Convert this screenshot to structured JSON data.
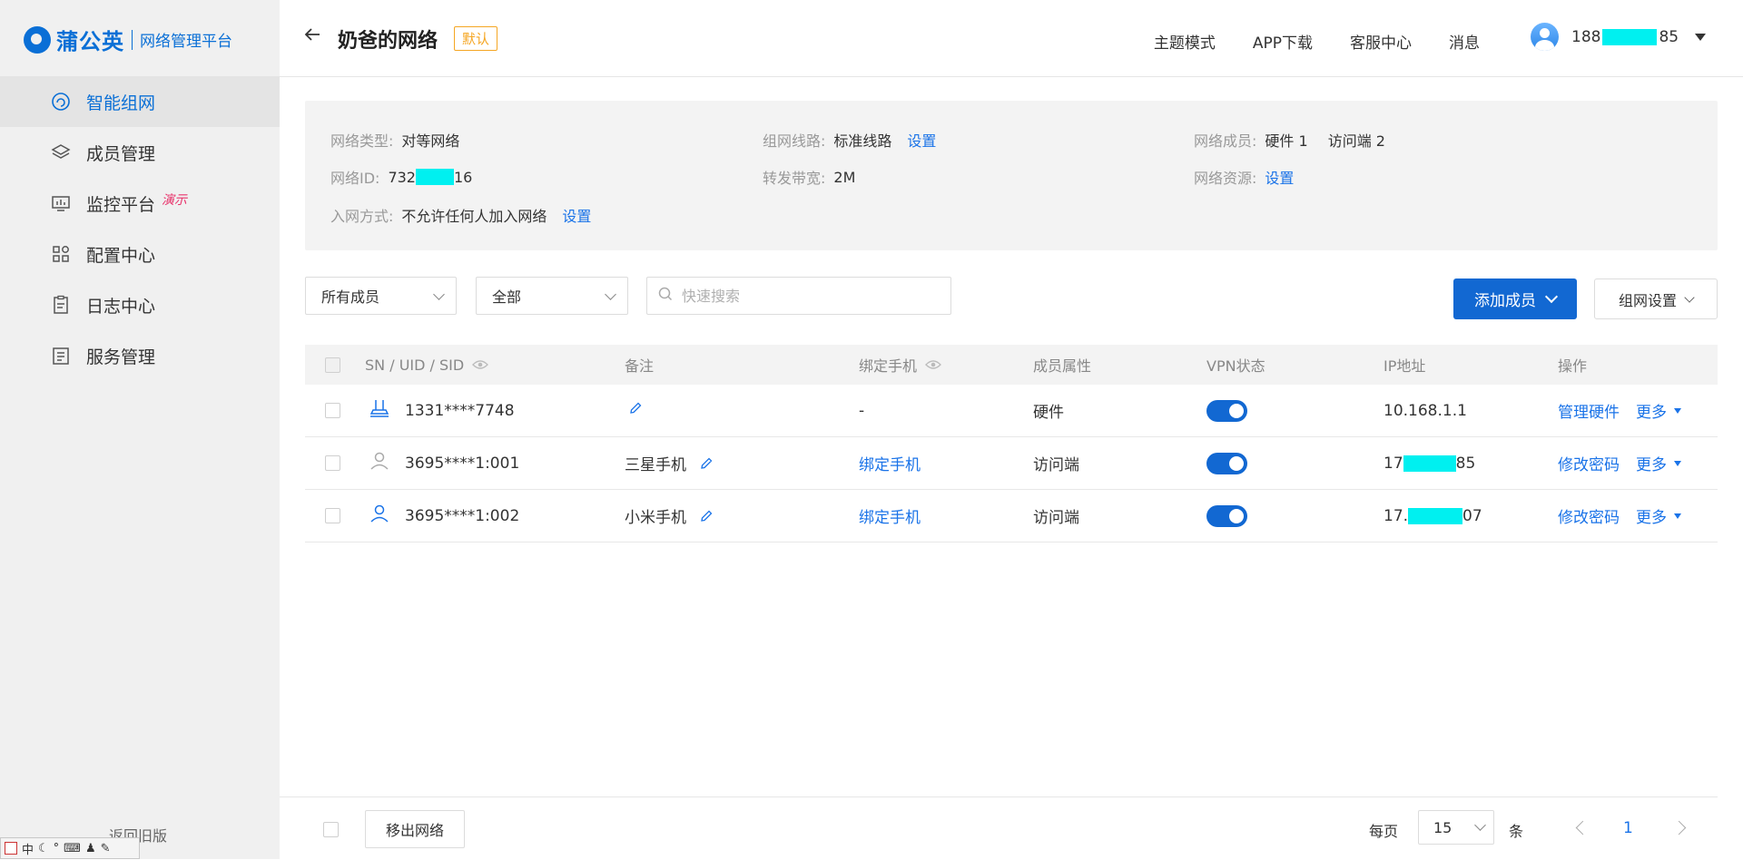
{
  "brand": {
    "name": "蒲公英",
    "subtitle": "网络管理平台"
  },
  "sidebar": {
    "items": [
      {
        "label": "智能组网",
        "icon": "network-icon",
        "active": true
      },
      {
        "label": "成员管理",
        "icon": "layers-icon"
      },
      {
        "label": "监控平台",
        "icon": "monitor-icon",
        "badge": "演示"
      },
      {
        "label": "配置中心",
        "icon": "grid-apps-icon"
      },
      {
        "label": "日志中心",
        "icon": "clipboard-icon"
      },
      {
        "label": "服务管理",
        "icon": "list-doc-icon"
      }
    ],
    "return_old": "返回旧版"
  },
  "ime": {
    "label": "中"
  },
  "header": {
    "title": "奶爸的网络",
    "tag": "默认",
    "links": [
      "主题模式",
      "APP下载",
      "客服中心",
      "消息"
    ],
    "user": {
      "phone_prefix": "188",
      "phone_suffix": "85"
    }
  },
  "info": {
    "network_type_label": "网络类型:",
    "network_type_value": "对等网络",
    "network_id_label": "网络ID:",
    "network_id_prefix": "732",
    "network_id_suffix": "16",
    "join_label": "入网方式:",
    "join_value": "不允许任何人加入网络",
    "join_link": "设置",
    "line_label": "组网线路:",
    "line_value": "标准线路",
    "line_link": "设置",
    "bandwidth_label": "转发带宽:",
    "bandwidth_value": "2M",
    "members_label": "网络成员:",
    "members_hw": "硬件 1",
    "members_client": "访问端 2",
    "resource_label": "网络资源:",
    "resource_link": "设置"
  },
  "filters": {
    "member_filter": "所有成员",
    "type_filter": "全部",
    "search_placeholder": "快速搜索",
    "add_member": "添加成员",
    "network_settings": "组网设置"
  },
  "table": {
    "headers": {
      "sn": "SN / UID / SID",
      "remark": "备注",
      "phone": "绑定手机",
      "attr": "成员属性",
      "vpn": "VPN状态",
      "ip": "IP地址",
      "ops": "操作"
    },
    "rows": [
      {
        "icon": "router-icon",
        "sn": "1331****7748",
        "remark": "",
        "phone": "-",
        "phone_is_link": false,
        "attr": "硬件",
        "vpn_on": true,
        "ip_prefix": "10.168.1.1",
        "ip_suffix": "",
        "ip_masked": false,
        "op": "管理硬件",
        "more": "更多"
      },
      {
        "icon": "user-gray-icon",
        "sn": "3695****1:001",
        "remark": "三星手机",
        "phone": "绑定手机",
        "phone_is_link": true,
        "attr": "访问端",
        "vpn_on": true,
        "ip_prefix": "17",
        "ip_suffix": "85",
        "ip_masked": true,
        "op": "修改密码",
        "more": "更多"
      },
      {
        "icon": "user-blue-icon",
        "sn": "3695****1:002",
        "remark": "小米手机",
        "phone": "绑定手机",
        "phone_is_link": true,
        "attr": "访问端",
        "vpn_on": true,
        "ip_prefix": "17.",
        "ip_suffix": "07",
        "ip_masked": true,
        "op": "修改密码",
        "more": "更多"
      }
    ]
  },
  "footer": {
    "move_out": "移出网络",
    "per_page_label": "每页",
    "page_size": "15",
    "per_page_unit": "条",
    "current_page": "1"
  },
  "colors": {
    "primary": "#1268d2",
    "link": "#1a73e8",
    "mask": "#00f0f0",
    "tag": "#f5a623",
    "badge": "#e8336b"
  }
}
